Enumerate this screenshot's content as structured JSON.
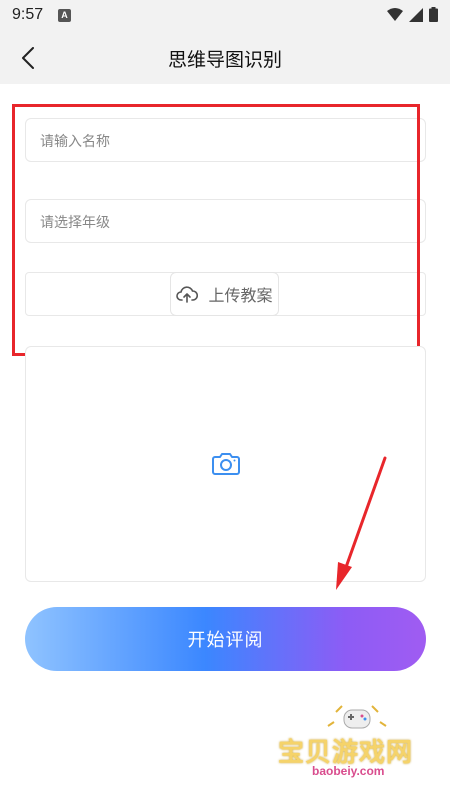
{
  "status_bar": {
    "time": "9:57",
    "notification_icon": "a-icon"
  },
  "header": {
    "title": "思维导图识别",
    "back_icon": "chevron-left-icon"
  },
  "form": {
    "name_placeholder": "请输入名称",
    "grade_placeholder": "请选择年级",
    "upload_label": "上传教案",
    "upload_icon": "cloud-upload-icon",
    "photo_icon": "camera-icon"
  },
  "start_button": {
    "label": "开始评阅"
  },
  "watermark": {
    "title": "宝贝游戏网",
    "url": "baobeiy.com"
  },
  "colors": {
    "annotation_red": "#e8262b",
    "gradient_start": "#8fc3ff",
    "gradient_mid": "#3b87ff",
    "gradient_end": "#a05cf2",
    "camera_blue": "#3c8ff0"
  }
}
